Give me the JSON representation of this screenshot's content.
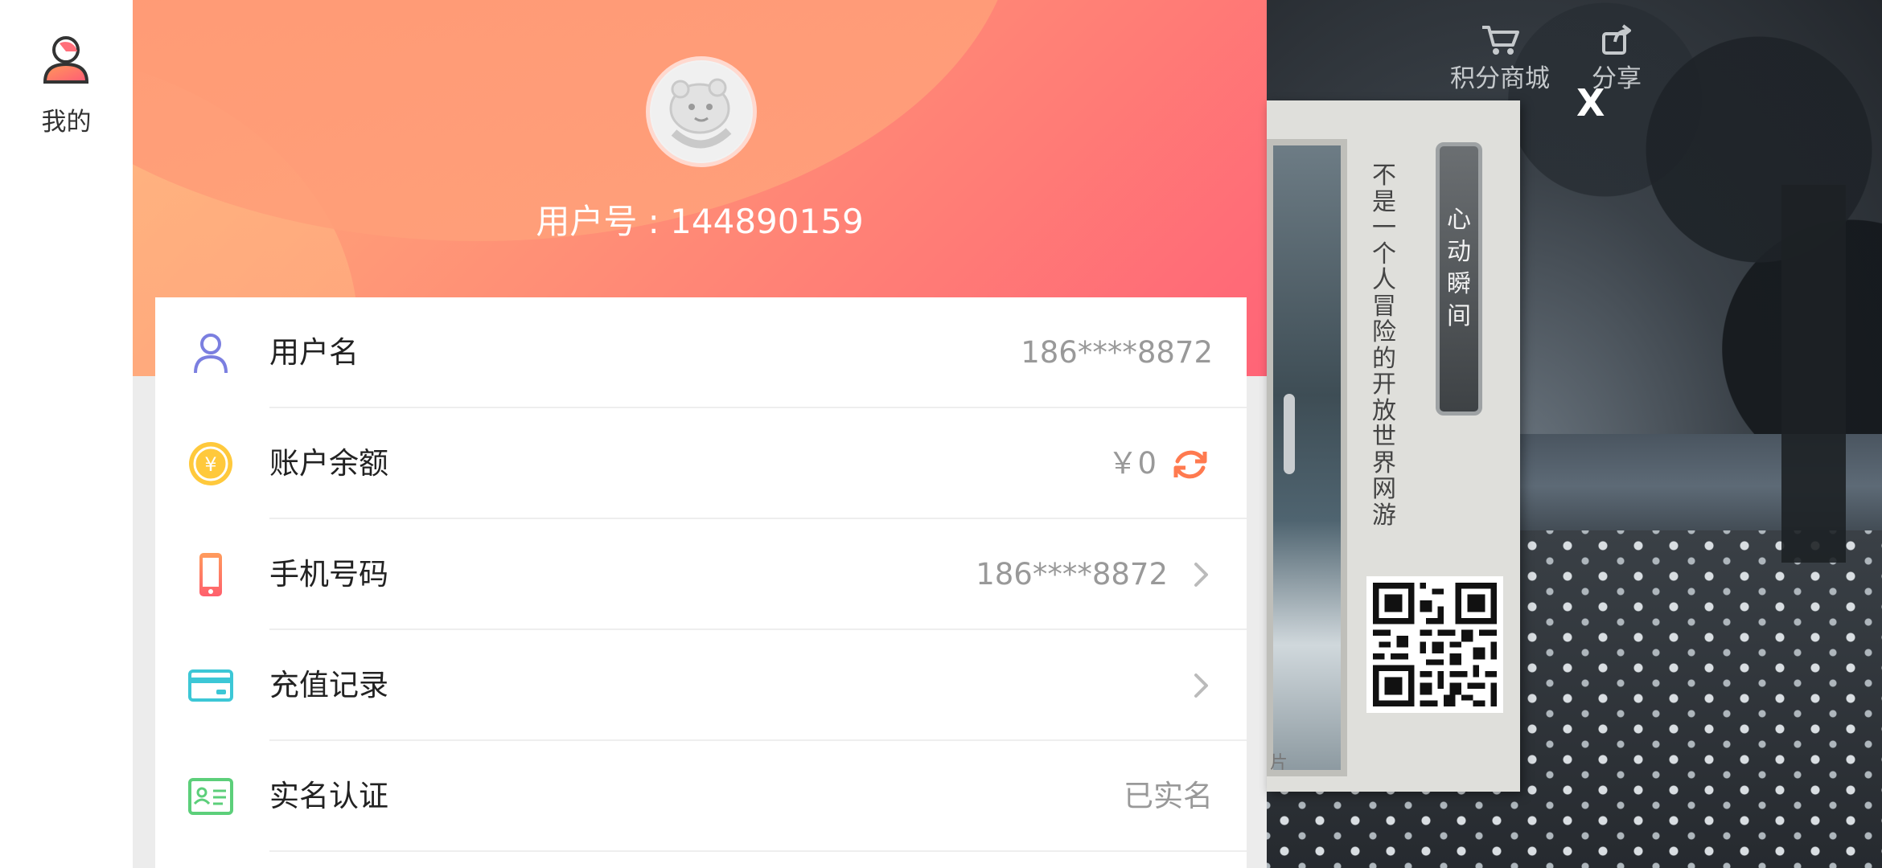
{
  "nav": {
    "mine_label": "我的"
  },
  "profile": {
    "user_id_text": "用户号 : 144890159"
  },
  "account_rows": [
    {
      "title": "用户名",
      "value": "186****8872"
    },
    {
      "title": "账户余额",
      "value": "￥0"
    },
    {
      "title": "手机号码",
      "value": "186****8872"
    },
    {
      "title": "充值记录",
      "value": ""
    },
    {
      "title": "实名认证",
      "value": "已实名"
    }
  ],
  "game_overlay": {
    "points_mall_label": "积分商城",
    "share_label": "分享",
    "close_glyph": "X",
    "poster_vertical_text": "不是一个人冒险的开放世界网游",
    "poster_banner_text": "心动瞬间",
    "poster_corner_text": "片"
  },
  "colors": {
    "accent_orange": "#ff6f61",
    "hero_gradient_start": "#ffb07a",
    "hero_gradient_end": "#ff6477",
    "row_value_gray": "#999999"
  },
  "icons": {
    "nav_mine": "person-icon",
    "username": "user-outline-icon",
    "balance": "yuan-coin-icon",
    "phone": "phone-icon",
    "recharge": "card-icon",
    "realname": "id-card-icon"
  }
}
